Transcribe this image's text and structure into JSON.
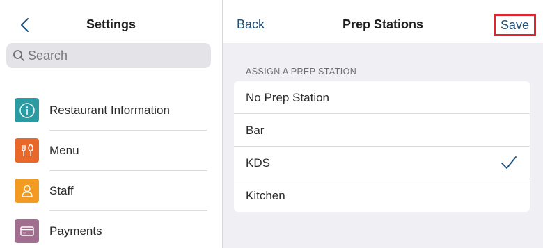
{
  "settings": {
    "title": "Settings",
    "search": {
      "placeholder": "Search"
    },
    "items": [
      {
        "label": "Restaurant Information",
        "icon": "info-icon",
        "color": "#2a9ba3"
      },
      {
        "label": "Menu",
        "icon": "utensils-icon",
        "color": "#e8682a"
      },
      {
        "label": "Staff",
        "icon": "person-icon",
        "color": "#f39a23"
      },
      {
        "label": "Payments",
        "icon": "card-icon",
        "color": "#a16e8f"
      }
    ]
  },
  "detail": {
    "back_label": "Back",
    "title": "Prep Stations",
    "save_label": "Save",
    "section_label": "ASSIGN A PREP STATION",
    "options": [
      {
        "label": "No Prep Station",
        "selected": false
      },
      {
        "label": "Bar",
        "selected": false
      },
      {
        "label": "KDS",
        "selected": true
      },
      {
        "label": "Kitchen",
        "selected": false
      }
    ]
  },
  "colors": {
    "accent": "#1c4f7c",
    "highlight_border": "#e0252f",
    "search_bg": "#e3e3e8",
    "detail_bg": "#efeff4"
  }
}
